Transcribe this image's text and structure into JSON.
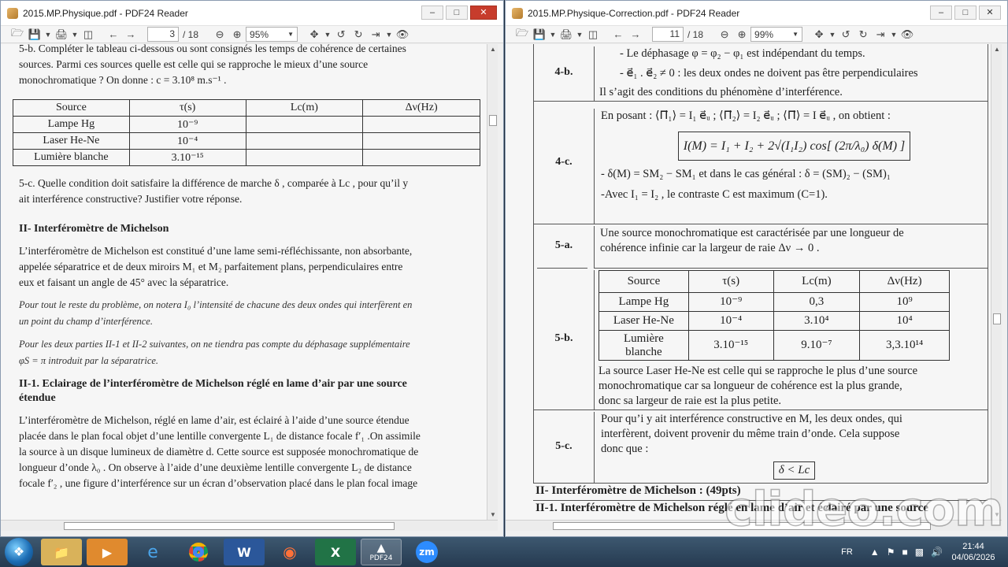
{
  "left_window": {
    "title": "2015.MP.Physique.pdf - PDF24 Reader",
    "page_current": "3",
    "page_total": "/ 18",
    "zoom": "95%",
    "doc": {
      "intro_lines": [
        "5-b. Compléter le tableau ci-dessous ou sont consignés les temps de cohérence de certaines",
        "sources. Parmi ces sources quelle est celle qui se rapproche le mieux d’une source",
        "monochromatique ? On donne : c = 3.10⁸ m.s⁻¹ ."
      ],
      "table": {
        "headers": [
          "Source",
          "τ(s)",
          "Lc(m)",
          "Δν(Hz)"
        ],
        "rows": [
          [
            "Lampe Hg",
            "10⁻⁹",
            "",
            ""
          ],
          [
            "Laser He-Ne",
            "10⁻⁴",
            "",
            ""
          ],
          [
            "Lumière blanche",
            "3.10⁻¹⁵",
            "",
            ""
          ]
        ]
      },
      "q5c_lines": [
        "5-c. Quelle condition doit satisfaire la différence de marche δ , comparée à Lc , pour qu’il y",
        "ait interférence constructive? Justifier votre réponse."
      ],
      "section_title": "II- Interféromètre de Michelson",
      "michelson_lines": [
        "L’interféromètre de Michelson est constitué d’une lame semi-réfléchissante, non absorbante,",
        "appelée séparatrice et de deux miroirs M₁ et M₂ parfaitement plans, perpendiculaires entre",
        "eux et faisant un angle de 45° avec la séparatrice."
      ],
      "italic1_lines": [
        "Pour tout le reste du problème, on notera I₀ l’intensité de chacune des deux ondes qui interfèrent en",
        "un point du champ d’interférence."
      ],
      "italic2_lines": [
        "Pour les deux parties II-1 et II-2 suivantes, on ne tiendra pas compte du déphasage supplémentaire",
        "φS = π introduit par la séparatrice."
      ],
      "sub_title_lines": [
        "II-1. Eclairage de l’interféromètre de Michelson réglé en lame d’air par une source",
        "étendue"
      ],
      "final_lines": [
        "L’interféromètre de Michelson, réglé en lame d’air, est éclairé à l’aide d’une source étendue",
        "placée dans le plan focal objet d’une lentille convergente L₁ de distance focale f′₁ .On assimile",
        "la source à un disque lumineux de diamètre d. Cette source est supposée monochromatique de",
        "longueur d’onde λ₀ . On observe à l’aide d’une deuxième lentille convergente L₂ de distance",
        "focale f′₂ , une figure d’interférence sur un écran d’observation placé dans le plan focal image"
      ]
    }
  },
  "right_window": {
    "title": "2015.MP.Physique-Correction.pdf - PDF24 Reader",
    "page_current": "11",
    "page_total": "/ 18",
    "zoom": "99%",
    "doc": {
      "q4b_label": "4-b.",
      "q4b_lines": [
        "-   Le déphasage   φ = φ₂ − φ₁  est indépendant du temps.",
        "-   e⃗₁ . e⃗₂ ≠ 0 : les deux ondes ne doivent pas être perpendiculaires",
        "Il s’agit des conditions du phénomène d’interférence."
      ],
      "q4c_label": "4-c.",
      "q4c_intro": "En posant : ⟨Π⃗₁⟩ = I₁ e⃗ᵤ ; ⟨Π⃗₂⟩ = I₂ e⃗ᵤ ; ⟨Π⃗⟩ = I e⃗ᵤ , on obtient :",
      "q4c_formula": "I(M) = I₁ + I₂ + 2√(I₁I₂) cos[ (2π/λ₀) δ(M) ]",
      "q4c_lines": [
        "-  δ(M) = SM₂ − SM₁  et dans le cas général : δ = (SM)₂ − (SM)₁",
        "-Avec   I₁ = I₂  , le contraste C est maximum (C=1)."
      ],
      "q5a_label": "5-a.",
      "q5a_lines": [
        "Une source monochromatique est caractérisée par une longueur de",
        "cohérence infinie car la largeur de raie Δν → 0 ."
      ],
      "q5b_label": "5-b.",
      "table": {
        "headers": [
          "Source",
          "τ(s)",
          "Lc(m)",
          "Δν(Hz)"
        ],
        "rows": [
          [
            "Lampe Hg",
            "10⁻⁹",
            "0,3",
            "10⁹"
          ],
          [
            "Laser He-Ne",
            "10⁻⁴",
            "3.10⁴",
            "10⁴"
          ],
          [
            "Lumière blanche",
            "3.10⁻¹⁵",
            "9.10⁻⁷",
            "3,3.10¹⁴"
          ]
        ]
      },
      "q5b_lines": [
        "La source Laser He-Ne est celle qui se rapproche le plus d’une source",
        "monochromatique car sa longueur de cohérence est la plus grande,",
        "donc sa largeur de raie est la plus petite."
      ],
      "q5c_label": "5-c.",
      "q5c_lines": [
        "Pour qu’i y ait interférence constructive  en M, les deux ondes, qui",
        "interfèrent, doivent provenir du même train d’onde. Cela  suppose",
        "donc que :"
      ],
      "q5c_formula": "δ < Lc",
      "section_title": "II- Interféromètre de Michelson : (49pts)",
      "sub_title": "II-1. Interféromètre de Michelson réglé en lame d’air et éclairé par une source"
    }
  },
  "taskbar": {
    "apps": [
      "explorer",
      "media-player",
      "internet-explorer",
      "chrome",
      "word",
      "firefox",
      "excel",
      "pdf24",
      "zoom"
    ],
    "pdf24_label": "PDF24",
    "zoom_label": "zm",
    "lang": "FR",
    "time": "21:44",
    "date": "04/06/2026"
  },
  "watermark": "clideo.com"
}
